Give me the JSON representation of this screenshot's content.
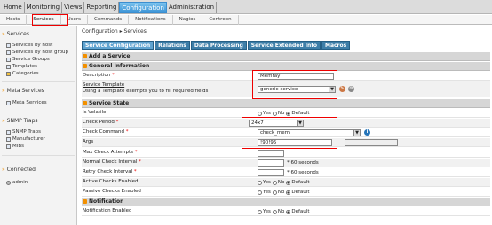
{
  "topnav": [
    "Home",
    "Monitoring",
    "Views",
    "Reporting",
    "Configuration",
    "Administration"
  ],
  "subnav": [
    "Hosts",
    "Services",
    "Users",
    "Commands",
    "Notifications",
    "Nagios",
    "Centreon"
  ],
  "sidebar": {
    "services_title": "Services",
    "services_items": [
      "Services by host",
      "Services by host group",
      "Service Groups",
      "Templates",
      "Categories"
    ],
    "meta_title": "Meta Services",
    "meta_items": [
      "Meta Services"
    ],
    "snmp_title": "SNMP Traps",
    "snmp_items": [
      "SNMP Traps",
      "Manufacturer",
      "MIBs"
    ],
    "connected_title": "Connected",
    "connected_user": "admin"
  },
  "breadcrumb": "Configuration  ▸  Services",
  "tabs": [
    "Service Configuration",
    "Relations",
    "Data Processing",
    "Service Extended Info",
    "Macros"
  ],
  "form": {
    "add_title": "Add a Service",
    "general_title": "General Information",
    "description_label": "Description",
    "description_value": "Memray",
    "template_label": "Service Template",
    "template_hint": "Using a Template exempts you to fill required fields",
    "template_value": "generic-service",
    "state_title": "Service State",
    "volatile_label": "Is Volatile",
    "check_period_label": "Check Period",
    "check_period_value": "24x7",
    "check_command_label": "Check Command",
    "check_command_value": "check_mem",
    "args_label": "Args",
    "args_value": "!90!95",
    "max_attempts_label": "Max Check Attempts",
    "normal_interval_label": "Normal Check Interval",
    "retry_interval_label": "Retry Check Interval",
    "seconds_note": "* 60 seconds",
    "active_label": "Active Checks Enabled",
    "passive_label": "Passive Checks Enabled",
    "notification_title": "Notification",
    "notif_enabled_label": "Notification Enabled",
    "radio_yes": "Yes",
    "radio_no": "No",
    "radio_default": "Default",
    "required_mark": "*"
  }
}
